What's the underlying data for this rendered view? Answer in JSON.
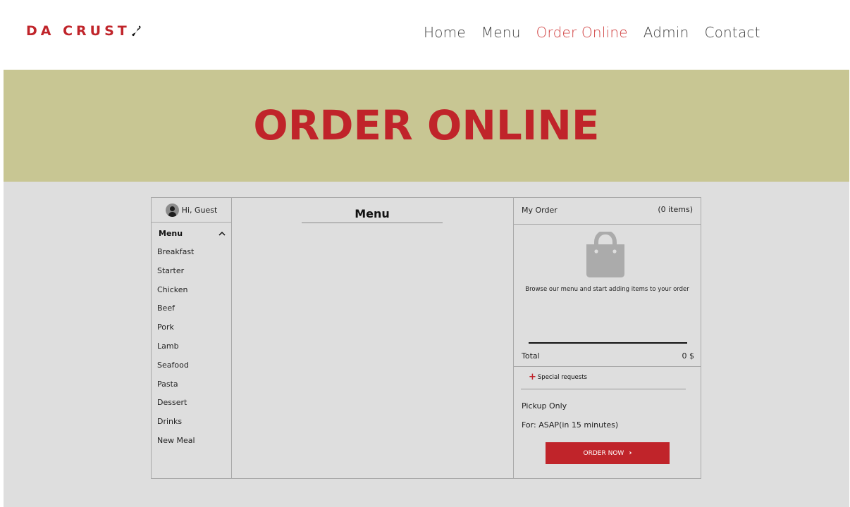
{
  "brand": {
    "logo_text": "DA CRUST",
    "logo_icon": "pizza-slice-icon",
    "accent_color": "#c0242a"
  },
  "nav": {
    "items": [
      {
        "label": "Home",
        "active": false
      },
      {
        "label": "Menu",
        "active": false
      },
      {
        "label": "Order Online",
        "active": true
      },
      {
        "label": "Admin",
        "active": false
      },
      {
        "label": "Contact",
        "active": false
      }
    ]
  },
  "hero": {
    "title": "ORDER ONLINE",
    "background_color": "#c8c693"
  },
  "sidebar": {
    "greeting": "Hi, Guest",
    "avatar_icon": "user-avatar-icon",
    "menu_label": "Menu",
    "collapse_icon": "chevron-up-icon",
    "categories": [
      "Breakfast",
      "Starter",
      "Chicken",
      "Beef",
      "Pork",
      "Lamb",
      "Seafood",
      "Pasta",
      "Dessert",
      "Drinks",
      "New Meal"
    ]
  },
  "main": {
    "title": "Menu"
  },
  "order": {
    "title": "My Order",
    "count": "(0 items)",
    "empty_icon": "shopping-bag-icon",
    "empty_message": "Browse our menu and start adding items to your order",
    "total_label": "Total",
    "total_value": "0 $",
    "special_requests": "Special requests",
    "pickup": "Pickup Only",
    "time": "For: ASAP(in 15 minutes)",
    "button_label": "ORDER NOW",
    "button_icon": "chevron-right-icon"
  }
}
